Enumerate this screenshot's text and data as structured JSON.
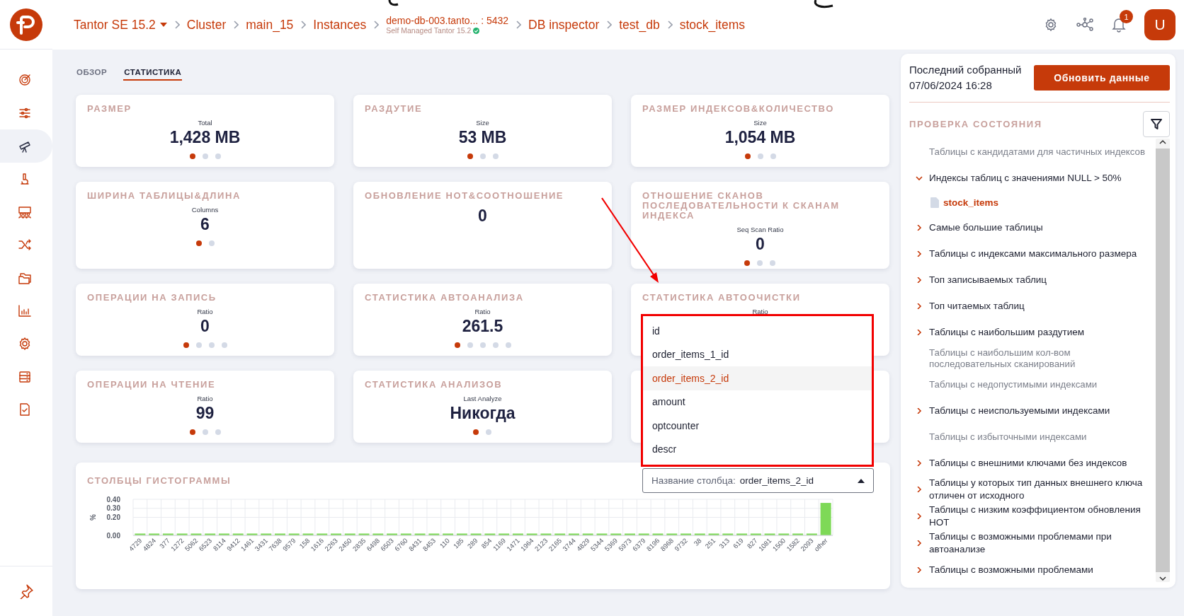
{
  "header": {
    "breadcrumbs": [
      {
        "label": "Tantor SE 15.2",
        "kind": "dropdown"
      },
      {
        "label": "Cluster",
        "kind": "link"
      },
      {
        "label": "main_15",
        "kind": "link"
      },
      {
        "label": "Instances",
        "kind": "link"
      },
      {
        "label": "demo-db-003.tanto... : 5432",
        "kind": "instance",
        "subtitle": "Self Managed Tantor 15.2"
      },
      {
        "label": "DB inspector",
        "kind": "link"
      },
      {
        "label": "test_db",
        "kind": "link"
      },
      {
        "label": "stock_items",
        "kind": "link"
      }
    ],
    "notifications": "1",
    "avatar": "U"
  },
  "sidebar": {
    "items": [
      {
        "selected": false
      },
      {
        "selected": false
      },
      {
        "selected": true
      },
      {
        "selected": false
      },
      {
        "selected": false
      },
      {
        "selected": false
      },
      {
        "selected": false
      },
      {
        "selected": false
      },
      {
        "selected": false
      },
      {
        "selected": false
      },
      {
        "selected": false
      }
    ]
  },
  "tabs": [
    {
      "label": "ОБЗОР",
      "selected": false
    },
    {
      "label": "СТАТИСТИКА",
      "selected": true
    }
  ],
  "cards": [
    {
      "kind": "stat",
      "title": "РАЗМЕР",
      "sublabel": "Total",
      "value": "1,428 MB",
      "dots": [
        {
          "selected": true
        },
        {
          "selected": false
        },
        {
          "selected": false
        }
      ]
    },
    {
      "kind": "stat",
      "title": "РАЗДУТИЕ",
      "sublabel": "Size",
      "value": "53 MB",
      "dots": [
        {
          "selected": true
        },
        {
          "selected": false
        },
        {
          "selected": false
        }
      ]
    },
    {
      "kind": "stat",
      "title": "РАЗМЕР ИНДЕКСОВ&КОЛИЧЕСТВО",
      "sublabel": "Size",
      "value": "1,054 MB",
      "dots": [
        {
          "selected": true
        },
        {
          "selected": false
        },
        {
          "selected": false
        }
      ]
    },
    {
      "kind": "stat",
      "title": "ШИРИНА ТАБЛИЦЫ&ДЛИНА",
      "sublabel": "Columns",
      "value": "6",
      "dots": [
        {
          "selected": true
        },
        {
          "selected": false
        }
      ]
    },
    {
      "kind": "stat",
      "title": "ОБНОВЛЕНИЕ HOT&СООТНОШЕНИЕ",
      "value": "0"
    },
    {
      "kind": "stat",
      "title": "ОТНОШЕНИЕ СКАНОВ ПОСЛЕДОВАТЕЛЬНОСТИ К СКАНАМ ИНДЕКСА",
      "sublabel": "Seq Scan Ratio",
      "value": "0",
      "dots": [
        {
          "selected": true
        },
        {
          "selected": false
        },
        {
          "selected": false
        }
      ]
    },
    {
      "kind": "stat",
      "title": "ОПЕРАЦИИ НА ЗАПИСЬ",
      "sublabel": "Ratio",
      "value": "0",
      "dots": [
        {
          "selected": true
        },
        {
          "selected": false
        },
        {
          "selected": false
        },
        {
          "selected": false
        }
      ]
    },
    {
      "kind": "stat",
      "title": "СТАТИСТИКА АВТОАНАЛИЗА",
      "sublabel": "Ratio",
      "value": "261.5",
      "dots": [
        {
          "selected": true
        },
        {
          "selected": false
        },
        {
          "selected": false
        },
        {
          "selected": false
        },
        {
          "selected": false
        }
      ]
    },
    {
      "kind": "stat",
      "title": "СТАТИСТИКА АВТООЧИСТКИ",
      "sublabel": "Ratio"
    },
    {
      "kind": "stat",
      "title": "ОПЕРАЦИИ НА ЧТЕНИЕ",
      "sublabel": "Ratio",
      "value": "99",
      "dots": [
        {
          "selected": true
        },
        {
          "selected": false
        },
        {
          "selected": false
        }
      ]
    },
    {
      "kind": "stat",
      "title": "СТАТИСТИКА АНАЛИЗОВ",
      "sublabel": "Last Analyze",
      "value": "Никогда",
      "dots": [
        {
          "selected": true
        },
        {
          "selected": false
        }
      ]
    },
    {
      "kind": "blank"
    }
  ],
  "histogram": {
    "title": "СТОЛБЦЫ ГИСТОГРАММЫ",
    "select": {
      "label": "Название столбца:",
      "value": "order_items_2_id",
      "expanded": true
    },
    "options": [
      {
        "label": "id",
        "selected": false
      },
      {
        "label": "order_items_1_id",
        "selected": false
      },
      {
        "label": "order_items_2_id",
        "selected": true
      },
      {
        "label": "amount",
        "selected": false
      },
      {
        "label": "optcounter",
        "selected": false
      },
      {
        "label": "descr",
        "selected": false
      }
    ],
    "chart_data": {
      "type": "bar",
      "ylabel": "%",
      "categories": [
        "4729",
        "4824",
        "377",
        "1272",
        "5062",
        "6523",
        "8114",
        "9412",
        "1461",
        "3431",
        "7638",
        "9579",
        "158",
        "1616",
        "2263",
        "2450",
        "2835",
        "6498",
        "6503",
        "6760",
        "8431",
        "8453",
        "110",
        "185",
        "289",
        "854",
        "1169",
        "1471",
        "1964",
        "2123",
        "2165",
        "3744",
        "4829",
        "5344",
        "5369",
        "5973",
        "6379",
        "8196",
        "8968",
        "9732",
        "38",
        "251",
        "313",
        "619",
        "827",
        "1081",
        "1500",
        "1582",
        "2093",
        "other"
      ],
      "series": [
        {
          "color": "#7ed957",
          "values": [
            0.02,
            0.02,
            0.02,
            0.02,
            0.02,
            0.02,
            0.02,
            0.02,
            0.02,
            0.02,
            0.02,
            0.02,
            0.02,
            0.02,
            0.02,
            0.02,
            0.02,
            0.02,
            0.02,
            0.02,
            0.02,
            0.02,
            0.02,
            0.02,
            0.02,
            0.02,
            0.02,
            0.02,
            0.02,
            0.02,
            0.02,
            0.02,
            0.02,
            0.02,
            0.02,
            0.02,
            0.02,
            0.02,
            0.02,
            0.02,
            0.02,
            0.02,
            0.02,
            0.02,
            0.02,
            0.02,
            0.02,
            0.02,
            0.02,
            0.36
          ]
        }
      ],
      "ylim": [
        0,
        0.4
      ],
      "yticks": [
        {
          "value": 0,
          "label": "0.00"
        },
        {
          "value": 0.2,
          "label": "0.20"
        },
        {
          "value": 0.3,
          "label": "0.30"
        },
        {
          "value": 0.4,
          "label": "0.40"
        }
      ]
    }
  },
  "health_panel": {
    "last_collected_label": "Последний собранный",
    "last_collected_time": "07/06/2024 16:28",
    "refresh_button": "Обновить данные",
    "title": "ПРОВЕРКА СОСТОЯНИЯ",
    "items": [
      {
        "kind": "empty",
        "label": "Таблицы с кандидатами для частичных индексов"
      },
      {
        "kind": "group",
        "label": "Индексы таблиц с значениями NULL > 50%",
        "expanded": true,
        "children": [
          {
            "label": "stock_items"
          }
        ]
      },
      {
        "kind": "group",
        "label": "Самые большие таблицы",
        "expanded": false
      },
      {
        "kind": "group",
        "label": "Таблицы с индексами максимального размера",
        "expanded": false
      },
      {
        "kind": "group",
        "label": "Топ записываемых таблиц",
        "expanded": false
      },
      {
        "kind": "group",
        "label": "Топ читаемых таблиц",
        "expanded": false
      },
      {
        "kind": "group",
        "label": "Таблицы с наибольшим раздутием",
        "expanded": false
      },
      {
        "kind": "empty",
        "label": "Таблицы с наибольшим кол-вом последовательных сканирований"
      },
      {
        "kind": "empty",
        "label": "Таблицы с недопустимыми индексами"
      },
      {
        "kind": "group",
        "label": "Таблицы с неиспользуемыми индексами",
        "expanded": false
      },
      {
        "kind": "empty",
        "label": "Таблицы с избыточными индексами"
      },
      {
        "kind": "group",
        "label": "Таблицы с внешними ключами без индексов",
        "expanded": false
      },
      {
        "kind": "group",
        "label": "Таблицы у которых тип данных внешнего ключа отличен от исходного",
        "expanded": false
      },
      {
        "kind": "group",
        "label": "Таблицы с низким коэффициентом обновления HOT",
        "expanded": false
      },
      {
        "kind": "group",
        "label": "Таблицы с возможными проблемами при автоанализе",
        "expanded": false
      },
      {
        "kind": "group",
        "label": "Таблицы с возможными проблемами",
        "expanded": false
      }
    ]
  }
}
